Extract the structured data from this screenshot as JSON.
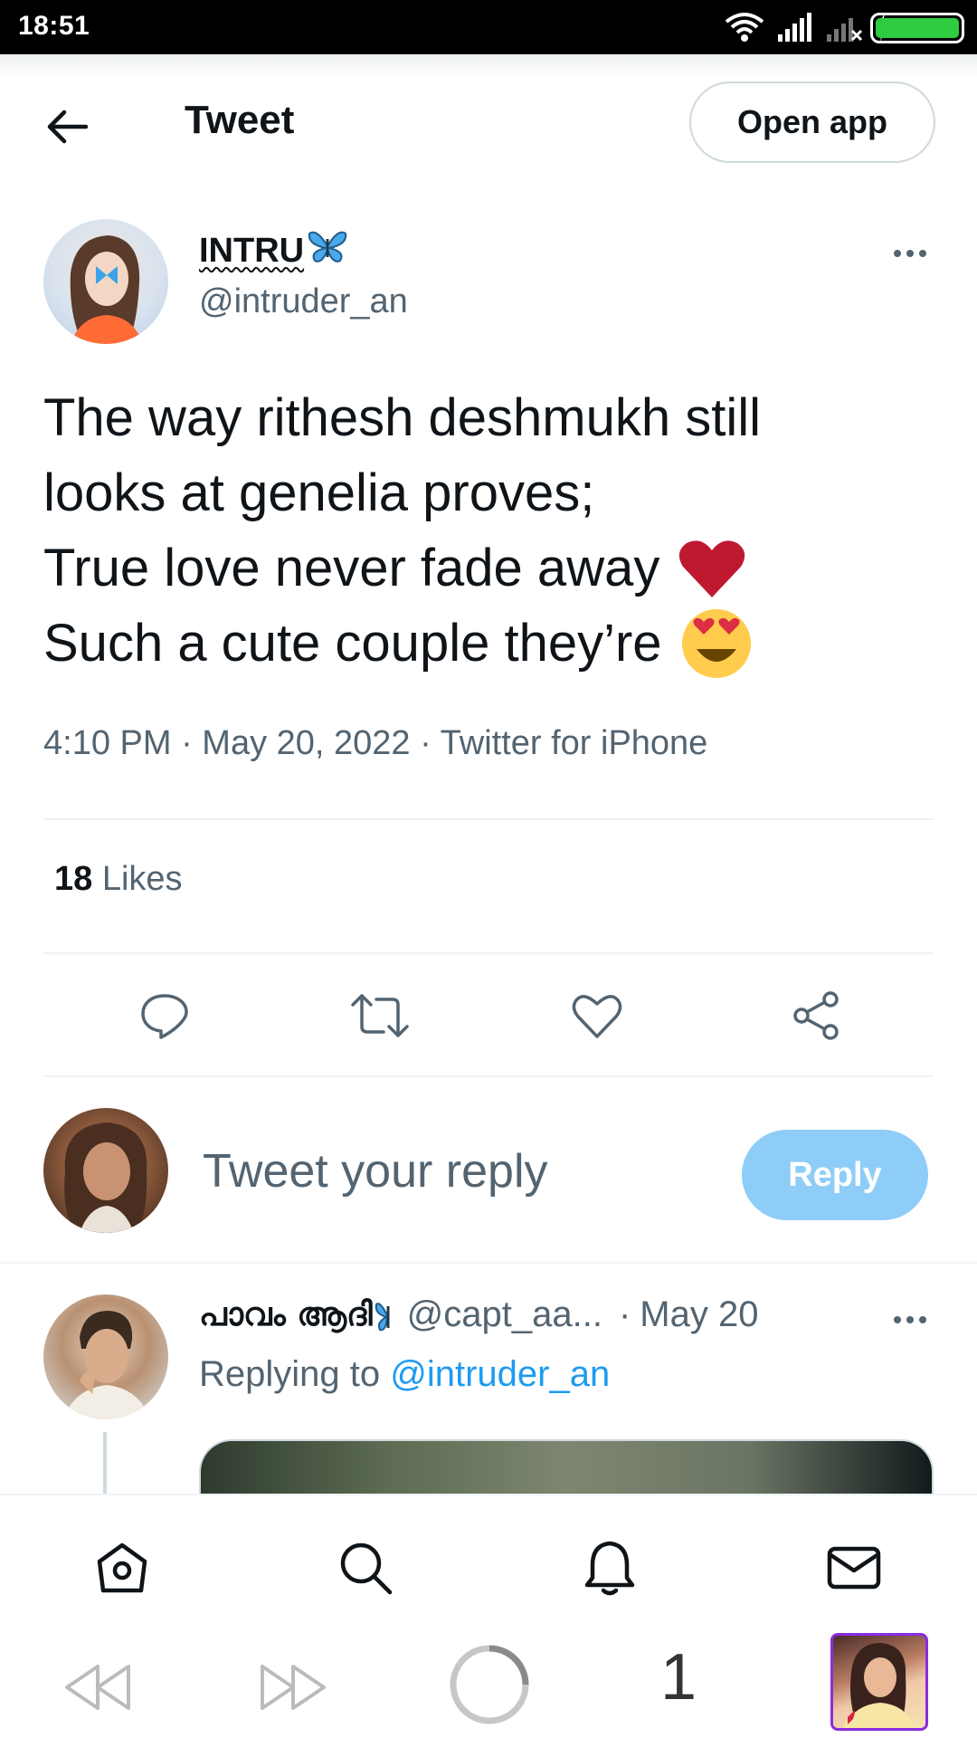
{
  "status_bar": {
    "time": "18:51",
    "battery_level": 1.0,
    "icons": [
      "wifi-icon",
      "signal-icon",
      "signal-x-icon",
      "charging-icon",
      "battery-icon"
    ]
  },
  "top_bar": {
    "title": "Tweet",
    "open_app_label": "Open app"
  },
  "tweet": {
    "author_name": "INTRU",
    "author_emoji": "butterfly-icon",
    "author_handle": "@intruder_an",
    "lines": [
      "The way rithesh deshmukh still",
      "looks at genelia proves;",
      "True love never fade away",
      "Such a cute couple they’re"
    ],
    "line_emojis": [
      "",
      "",
      "red-heart-emoji",
      "heart-eyes-emoji"
    ],
    "meta": "4:10 PM · May 20, 2022 · Twitter for iPhone",
    "likes_count": "18",
    "likes_label": "Likes"
  },
  "actions": [
    "reply-icon",
    "retweet-icon",
    "like-icon",
    "share-icon"
  ],
  "composer": {
    "placeholder": "Tweet your reply",
    "reply_label": "Reply"
  },
  "reply": {
    "author_name": "പാവം ആദി",
    "author_handle": "@capt_aa...",
    "separator": "·",
    "date": "May 20",
    "replying_prefix": "Replying to",
    "replying_to": "@intruder_an"
  },
  "bottom_nav": [
    "home-icon",
    "search-icon",
    "notifications-icon",
    "messages-icon"
  ],
  "browser_bar": {
    "tab_count": "1"
  },
  "colors": {
    "accent": "#1d9bf0",
    "reply_button": "#8ecdf8",
    "muted_text": "#536471",
    "divider": "#eff3f4"
  }
}
